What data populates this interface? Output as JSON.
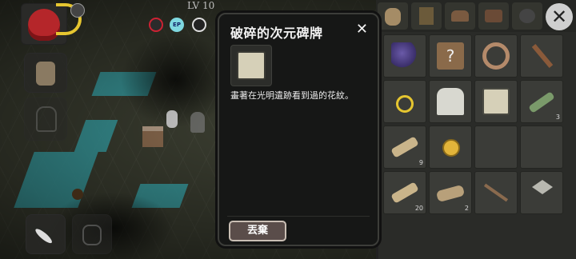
{
  "hud": {
    "level": "LV 10",
    "stat_ep": "EP"
  },
  "dialog": {
    "title": "破碎的次元碑牌",
    "close_glyph": "✕",
    "description": "畫著在光明遺跡看到過的花紋。",
    "discard_label": "丟棄"
  },
  "inventory": {
    "close_glyph": "✕",
    "items": [
      {
        "name": "grapes",
        "count": ""
      },
      {
        "name": "mystery-recipe",
        "count": ""
      },
      {
        "name": "mechanical-part",
        "count": ""
      },
      {
        "name": "shovel",
        "count": ""
      },
      {
        "name": "ring-with-ribbon",
        "count": ""
      },
      {
        "name": "white-cloak",
        "count": ""
      },
      {
        "name": "broken-tablet",
        "count": ""
      },
      {
        "name": "grass-bundle",
        "count": "3"
      },
      {
        "name": "straw",
        "count": "9"
      },
      {
        "name": "gold-coin",
        "count": ""
      },
      {
        "name": "empty",
        "count": ""
      },
      {
        "name": "empty",
        "count": ""
      },
      {
        "name": "straw",
        "count": "20"
      },
      {
        "name": "log",
        "count": "2"
      },
      {
        "name": "wooden-stick",
        "count": ""
      },
      {
        "name": "axe",
        "count": ""
      }
    ]
  },
  "colors": {
    "water": "#3aa3a8",
    "dialog_bg": "#161716",
    "discard_bg": "#5a4d4a",
    "accent_yellow": "#e6c630"
  }
}
